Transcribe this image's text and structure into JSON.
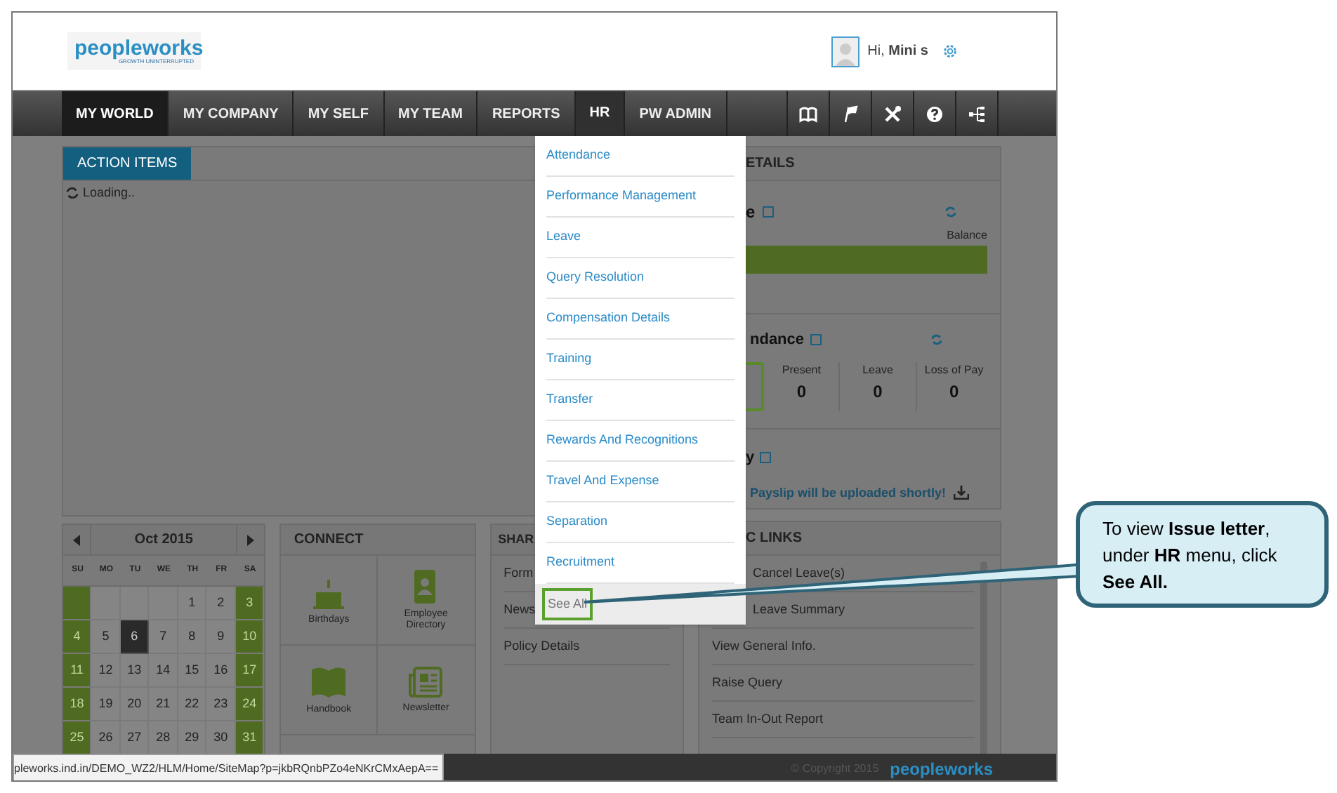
{
  "header": {
    "logo": "peopleworks",
    "tagline": "GROWTH UNINTERRUPTED",
    "greeting": "Hi, **Mini s**"
  },
  "nav": [
    {
      "label": "MY WORLD",
      "selected": true,
      "expanded": false
    },
    {
      "label": "MY COMPANY",
      "selected": false,
      "expanded": false
    },
    {
      "label": "MY SELF",
      "selected": false,
      "expanded": false
    },
    {
      "label": "MY TEAM",
      "selected": false,
      "expanded": false
    },
    {
      "label": "REPORTS",
      "selected": false,
      "expanded": false
    },
    {
      "label": "HR",
      "selected": false,
      "expanded": true
    },
    {
      "label": "PW ADMIN",
      "selected": false,
      "expanded": false
    }
  ],
  "nav_icons": [
    {
      "kind": "book"
    },
    {
      "kind": "flags"
    },
    {
      "kind": "tools"
    },
    {
      "kind": "help"
    },
    {
      "kind": "sitemap"
    }
  ],
  "hr_menu": [
    {
      "label": "Attendance",
      "highlighted": false
    },
    {
      "label": "Performance Management",
      "highlighted": false
    },
    {
      "label": "Leave",
      "highlighted": false
    },
    {
      "label": "Query Resolution",
      "highlighted": false
    },
    {
      "label": "Compensation Details",
      "highlighted": false
    },
    {
      "label": "Training",
      "highlighted": false
    },
    {
      "label": "Transfer",
      "highlighted": false
    },
    {
      "label": "Rewards And Recognitions",
      "highlighted": false
    },
    {
      "label": "Travel And Expense",
      "highlighted": false
    },
    {
      "label": "Separation",
      "highlighted": false
    },
    {
      "label": "Recruitment",
      "highlighted": false
    },
    {
      "label": "See All",
      "highlighted": true
    }
  ],
  "action_items": {
    "tab": "ACTION ITEMS",
    "status": "Loading.."
  },
  "details": {
    "title": "ETAILS",
    "leave": {
      "title": "e",
      "column": "Balance"
    },
    "attendance": {
      "title": "ndance",
      "stats": [
        {
          "label": "Present",
          "value": "0"
        },
        {
          "label": "Leave",
          "value": "0"
        },
        {
          "label": "Loss of Pay",
          "value": "0"
        }
      ]
    },
    "payslip": {
      "title": "y",
      "message": "Payslip will be uploaded shortly!"
    }
  },
  "calendar": {
    "month": "Oct 2015",
    "weekdays": [
      "SU",
      "MO",
      "TU",
      "WE",
      "TH",
      "FR",
      "SA"
    ],
    "days": [
      {
        "kind": "blank"
      },
      {
        "kind": "blank"
      },
      {
        "kind": "blank"
      },
      {
        "kind": "blank"
      },
      {
        "kind": "day",
        "day": "1",
        "selected": false
      },
      {
        "kind": "day",
        "day": "2",
        "selected": false
      },
      {
        "kind": "day",
        "day": "3",
        "selected": false
      },
      {
        "kind": "day",
        "day": "4",
        "selected": false
      },
      {
        "kind": "day",
        "day": "5",
        "selected": false
      },
      {
        "kind": "day",
        "day": "6",
        "selected": true
      },
      {
        "kind": "day",
        "day": "7",
        "selected": false
      },
      {
        "kind": "day",
        "day": "8",
        "selected": false
      },
      {
        "kind": "day",
        "day": "9",
        "selected": false
      },
      {
        "kind": "day",
        "day": "10",
        "selected": false
      },
      {
        "kind": "day",
        "day": "11",
        "selected": false
      },
      {
        "kind": "day",
        "day": "12",
        "selected": false
      },
      {
        "kind": "day",
        "day": "13",
        "selected": false
      },
      {
        "kind": "day",
        "day": "14",
        "selected": false
      },
      {
        "kind": "day",
        "day": "15",
        "selected": false
      },
      {
        "kind": "day",
        "day": "16",
        "selected": false
      },
      {
        "kind": "day",
        "day": "17",
        "selected": false
      },
      {
        "kind": "day",
        "day": "18",
        "selected": false
      },
      {
        "kind": "day",
        "day": "19",
        "selected": false
      },
      {
        "kind": "day",
        "day": "20",
        "selected": false
      },
      {
        "kind": "day",
        "day": "21",
        "selected": false
      },
      {
        "kind": "day",
        "day": "22",
        "selected": false
      },
      {
        "kind": "day",
        "day": "23",
        "selected": false
      },
      {
        "kind": "day",
        "day": "24",
        "selected": false
      },
      {
        "kind": "day",
        "day": "25",
        "selected": false
      },
      {
        "kind": "day",
        "day": "26",
        "selected": false
      },
      {
        "kind": "day",
        "day": "27",
        "selected": false
      },
      {
        "kind": "day",
        "day": "28",
        "selected": false
      },
      {
        "kind": "day",
        "day": "29",
        "selected": false
      },
      {
        "kind": "day",
        "day": "30",
        "selected": false
      },
      {
        "kind": "day",
        "day": "31",
        "selected": false
      }
    ]
  },
  "connect": {
    "title": "CONNECT",
    "tiles": [
      {
        "kind": "cake",
        "label": "Birthdays"
      },
      {
        "kind": "contacts",
        "label": "Employee Directory"
      },
      {
        "kind": "book",
        "label": "Handbook"
      },
      {
        "kind": "news",
        "label": "Newsletter"
      }
    ]
  },
  "shared": {
    "title": "SHAR",
    "links": [
      "Form",
      "News",
      "Policy Details"
    ]
  },
  "quick_links": {
    "title": "C LINKS",
    "items": [
      "Cancel Leave(s)",
      "Leave Summary",
      "View General Info.",
      "Raise Query",
      "Team In-Out Report"
    ]
  },
  "status_bar": {
    "url": "pleworks.ind.in/DEMO_WZ2/HLM/Home/SiteMap?p=jkbRQnbPZo4eNKrCMxAepA==",
    "copyright": "© Copyright 2015",
    "logo": "peopleworks"
  },
  "callout": {
    "text": "To view **Issue letter**, under **HR** menu, click **See All.**"
  }
}
